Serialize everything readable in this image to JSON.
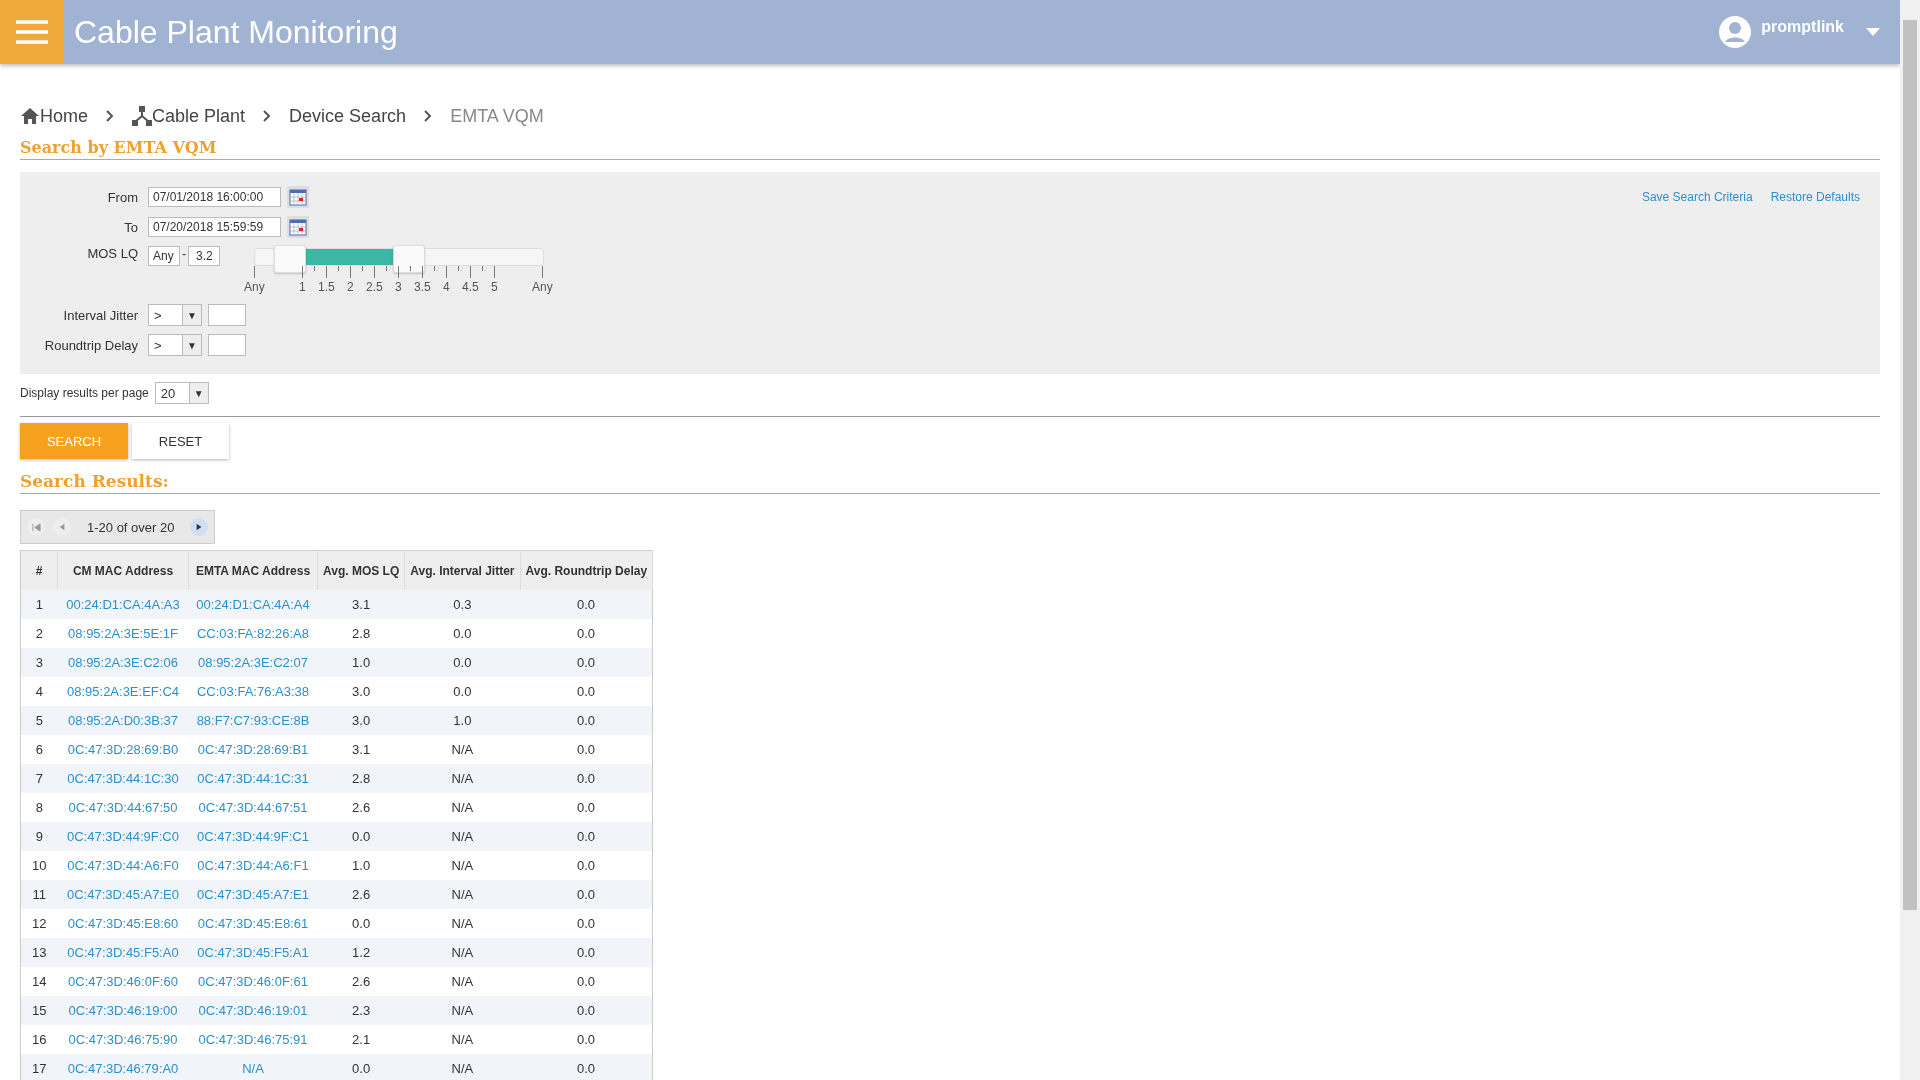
{
  "header": {
    "title": "Cable Plant Monitoring",
    "user": "promptlink"
  },
  "breadcrumb": [
    {
      "label": "Home",
      "kind": "home",
      "current": false
    },
    {
      "label": "Cable Plant",
      "kind": "network",
      "current": false
    },
    {
      "label": "Device Search",
      "kind": "plain",
      "current": false
    },
    {
      "label": "EMTA VQM",
      "kind": "plain",
      "current": true
    }
  ],
  "search_title": "Search by EMTA VQM",
  "form": {
    "from": {
      "label": "From",
      "value": "07/01/2018 16:00:00"
    },
    "to": {
      "label": "To",
      "value": "07/20/2018 15:59:59"
    },
    "mos": {
      "label": "MOS LQ",
      "min": "Any",
      "separator": "-",
      "max": "3.2",
      "thumbs": [
        {
          "level": 0.12
        },
        {
          "level": 0.535
        }
      ],
      "ticks": [
        "Any",
        "1",
        "1.5",
        "2",
        "2.5",
        "3",
        "3.5",
        "4",
        "4.5",
        "5",
        "Any"
      ]
    },
    "filters": [
      {
        "label": "Interval Jitter",
        "operator": ">",
        "arrow": "▼"
      },
      {
        "label": "Roundtrip Delay",
        "operator": ">",
        "arrow": "▼"
      }
    ],
    "links": [
      "Save Search Criteria",
      "Restore Defaults"
    ]
  },
  "per_page": {
    "label": "Display results per page",
    "value": "20",
    "arrow": "▼"
  },
  "buttons": [
    {
      "label": "SEARCH",
      "kind": "primary"
    },
    {
      "label": "RESET",
      "kind": "secondary"
    }
  ],
  "results_title": "Search Results:",
  "pager": {
    "text": "1-20 of over 20"
  },
  "table": {
    "columns": [
      "#",
      "CM MAC Address",
      "EMTA MAC Address",
      "Avg. MOS LQ",
      "Avg. Interval Jitter",
      "Avg. Roundtrip Delay"
    ],
    "rows": [
      [
        "1",
        "00:24:D1:CA:4A:A3",
        "00:24:D1:CA:4A:A4",
        "3.1",
        "0.3",
        "0.0"
      ],
      [
        "2",
        "08:95:2A:3E:5E:1F",
        "CC:03:FA:82:26:A8",
        "2.8",
        "0.0",
        "0.0"
      ],
      [
        "3",
        "08:95:2A:3E:C2:06",
        "08:95:2A:3E:C2:07",
        "1.0",
        "0.0",
        "0.0"
      ],
      [
        "4",
        "08:95:2A:3E:EF:C4",
        "CC:03:FA:76:A3:38",
        "3.0",
        "0.0",
        "0.0"
      ],
      [
        "5",
        "08:95:2A:D0:3B:37",
        "88:F7:C7:93:CE:8B",
        "3.0",
        "1.0",
        "0.0"
      ],
      [
        "6",
        "0C:47:3D:28:69:B0",
        "0C:47:3D:28:69:B1",
        "3.1",
        "N/A",
        "0.0"
      ],
      [
        "7",
        "0C:47:3D:44:1C:30",
        "0C:47:3D:44:1C:31",
        "2.8",
        "N/A",
        "0.0"
      ],
      [
        "8",
        "0C:47:3D:44:67:50",
        "0C:47:3D:44:67:51",
        "2.6",
        "N/A",
        "0.0"
      ],
      [
        "9",
        "0C:47:3D:44:9F:C0",
        "0C:47:3D:44:9F:C1",
        "0.0",
        "N/A",
        "0.0"
      ],
      [
        "10",
        "0C:47:3D:44:A6:F0",
        "0C:47:3D:44:A6:F1",
        "1.0",
        "N/A",
        "0.0"
      ],
      [
        "11",
        "0C:47:3D:45:A7:E0",
        "0C:47:3D:45:A7:E1",
        "2.6",
        "N/A",
        "0.0"
      ],
      [
        "12",
        "0C:47:3D:45:E8:60",
        "0C:47:3D:45:E8:61",
        "0.0",
        "N/A",
        "0.0"
      ],
      [
        "13",
        "0C:47:3D:45:F5:A0",
        "0C:47:3D:45:F5:A1",
        "1.2",
        "N/A",
        "0.0"
      ],
      [
        "14",
        "0C:47:3D:46:0F:60",
        "0C:47:3D:46:0F:61",
        "2.6",
        "N/A",
        "0.0"
      ],
      [
        "15",
        "0C:47:3D:46:19:00",
        "0C:47:3D:46:19:01",
        "2.3",
        "N/A",
        "0.0"
      ],
      [
        "16",
        "0C:47:3D:46:75:90",
        "0C:47:3D:46:75:91",
        "2.1",
        "N/A",
        "0.0"
      ],
      [
        "17",
        "0C:47:3D:46:79:A0",
        "N/A",
        "0.0",
        "N/A",
        "0.0"
      ]
    ]
  }
}
